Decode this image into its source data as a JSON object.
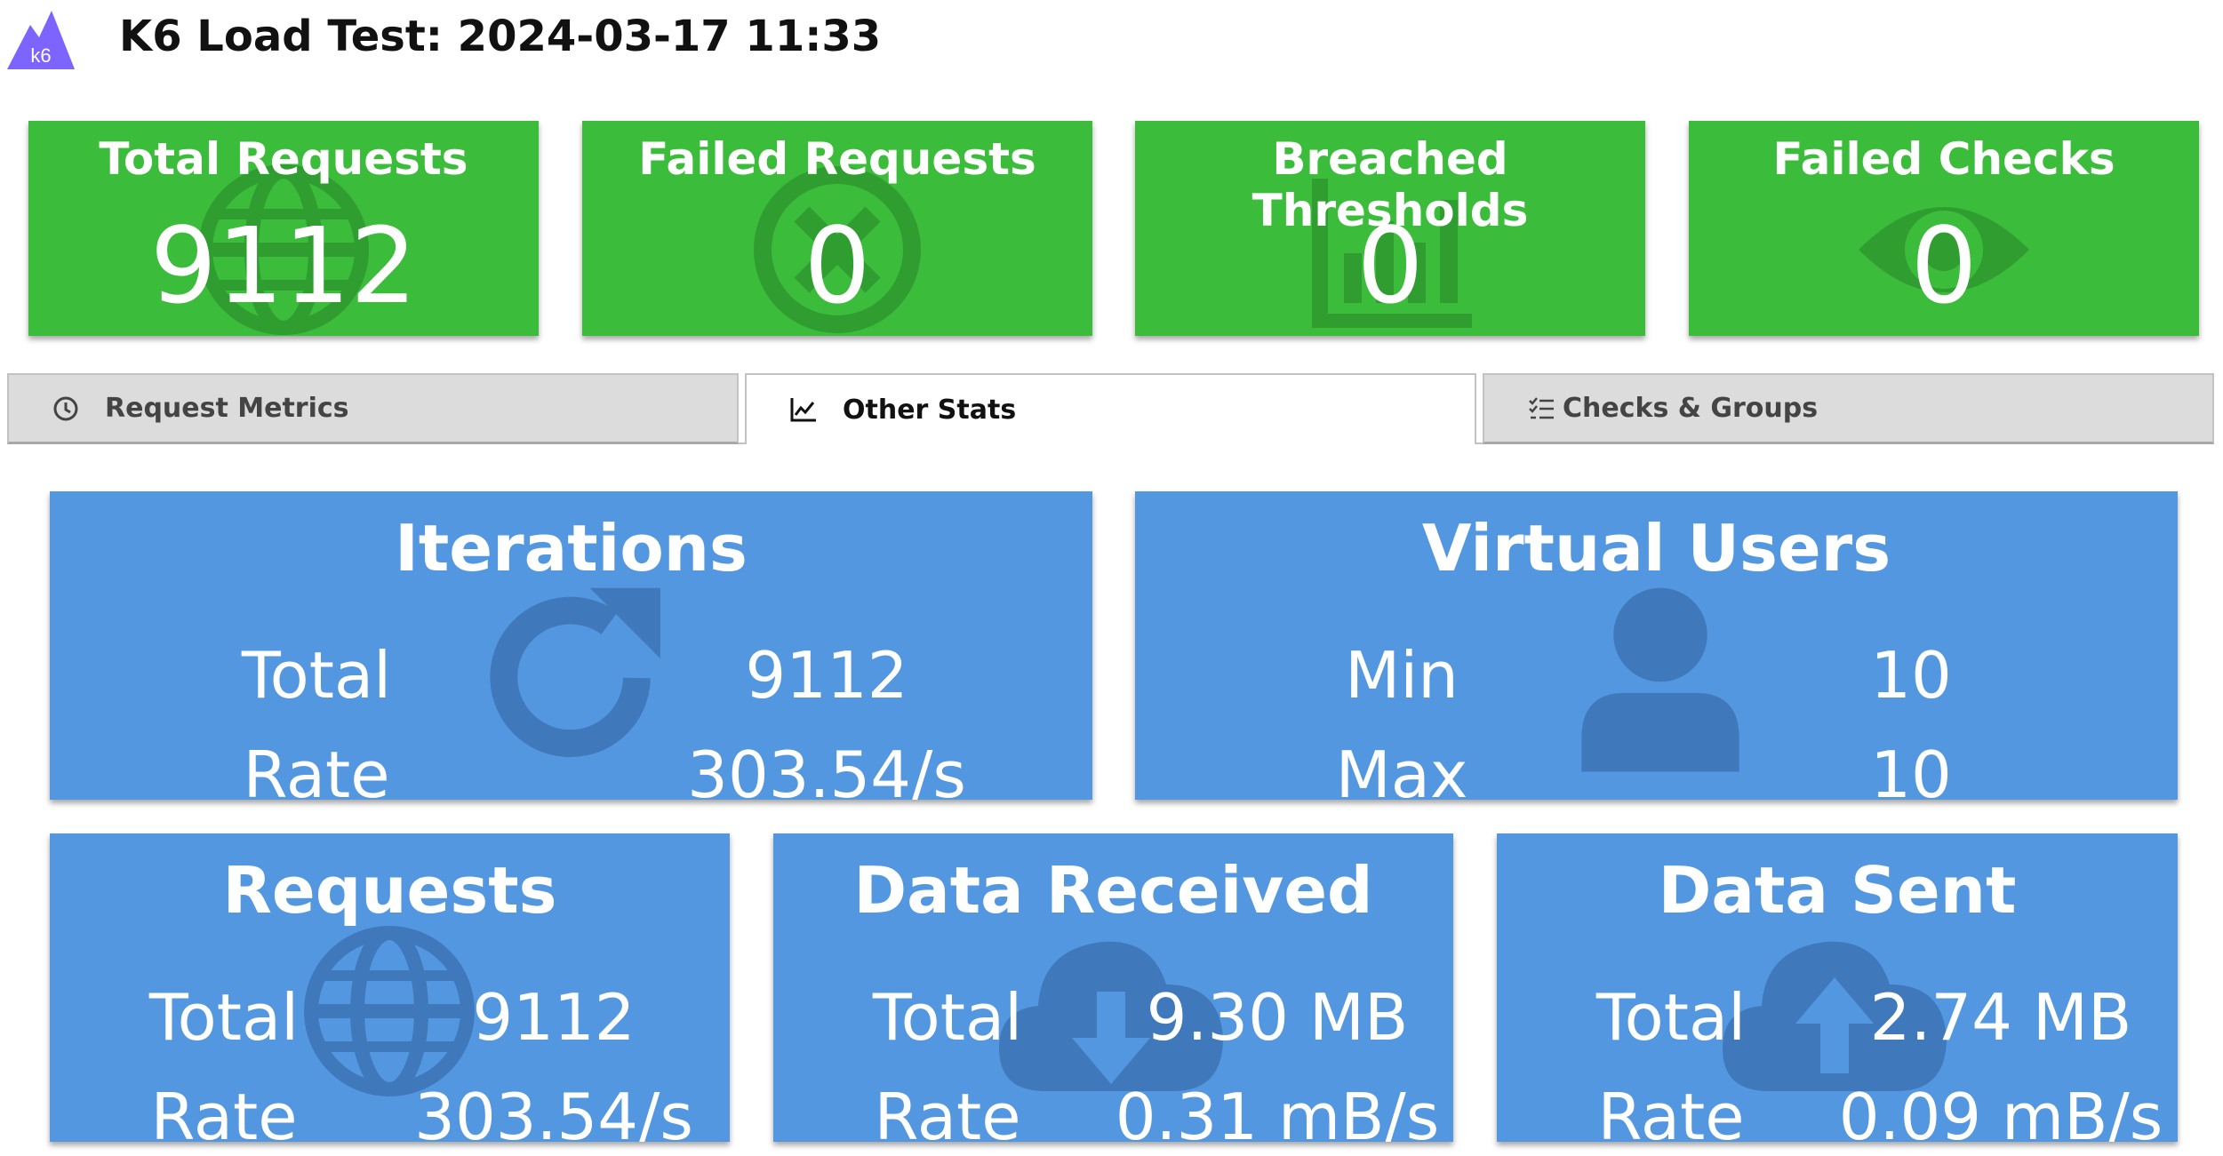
{
  "header": {
    "title": "K6 Load Test: 2024-03-17 11:33",
    "logo_text": "k6"
  },
  "summary": [
    {
      "label": "Total Requests",
      "value": "9112",
      "icon": "globe-icon"
    },
    {
      "label": "Failed Requests",
      "value": "0",
      "icon": "circle-x-icon"
    },
    {
      "label": "Breached Thresholds",
      "value": "0",
      "icon": "bar-chart-icon"
    },
    {
      "label": "Failed Checks",
      "value": "0",
      "icon": "eye-icon"
    }
  ],
  "tabs": [
    {
      "label": "Request Metrics",
      "icon": "clock-icon",
      "active": false
    },
    {
      "label": "Other Stats",
      "icon": "line-chart-icon",
      "active": true
    },
    {
      "label": "Checks & Groups",
      "icon": "checklist-icon",
      "active": false
    }
  ],
  "stats": {
    "iterations": {
      "title": "Iterations",
      "row1_label": "Total",
      "row1_value": "9112",
      "row2_label": "Rate",
      "row2_value": "303.54/s",
      "icon": "refresh-icon"
    },
    "virtual_users": {
      "title": "Virtual Users",
      "row1_label": "Min",
      "row1_value": "10",
      "row2_label": "Max",
      "row2_value": "10",
      "icon": "user-icon"
    },
    "requests": {
      "title": "Requests",
      "row1_label": "Total",
      "row1_value": "9112",
      "row2_label": "Rate",
      "row2_value": "303.54/s",
      "icon": "globe-icon"
    },
    "data_received": {
      "title": "Data Received",
      "row1_label": "Total",
      "row1_value": "9.30 MB",
      "row2_label": "Rate",
      "row2_value": "0.31 mB/s",
      "icon": "cloud-download-icon"
    },
    "data_sent": {
      "title": "Data Sent",
      "row1_label": "Total",
      "row1_value": "2.74 MB",
      "row2_label": "Rate",
      "row2_value": "0.09 mB/s",
      "icon": "cloud-upload-icon"
    }
  },
  "colors": {
    "summary_green": "#3bbd3b",
    "summary_icon": "#2f9d2f",
    "stat_blue": "#5497e1",
    "stat_icon": "#3f78bb",
    "logo_purple": "#7d64ff"
  }
}
